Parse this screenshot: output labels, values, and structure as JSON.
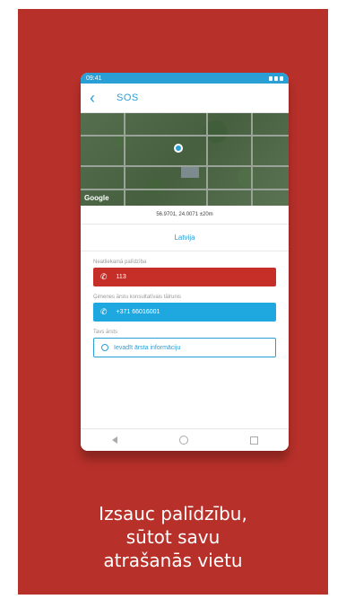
{
  "status_bar": {
    "time": "09:41"
  },
  "app_bar": {
    "back_icon": "chevron-left-icon",
    "title": "SOS"
  },
  "map": {
    "watermark": "Google",
    "coordinates": "56.9701, 24.0071 ±20m"
  },
  "country": {
    "selected": "Latvija"
  },
  "emergency": {
    "label": "Neatliekamā palīdzība",
    "number": "113"
  },
  "consultation": {
    "label": "Ģimenes ārstu konsultatīvais tālrunis",
    "number": "+371 66016001"
  },
  "doctor": {
    "label": "Tavs ārsts",
    "button": "Ievadīt ārsta informāciju"
  },
  "caption": {
    "line1": "Izsauc palīdzību,",
    "line2": "sūtot savu",
    "line3": "atrašanās vietu"
  },
  "colors": {
    "background": "#b8302a",
    "accent": "#2a9fd6",
    "emergency_red": "#c62f28",
    "call_blue": "#1fa8e0"
  }
}
